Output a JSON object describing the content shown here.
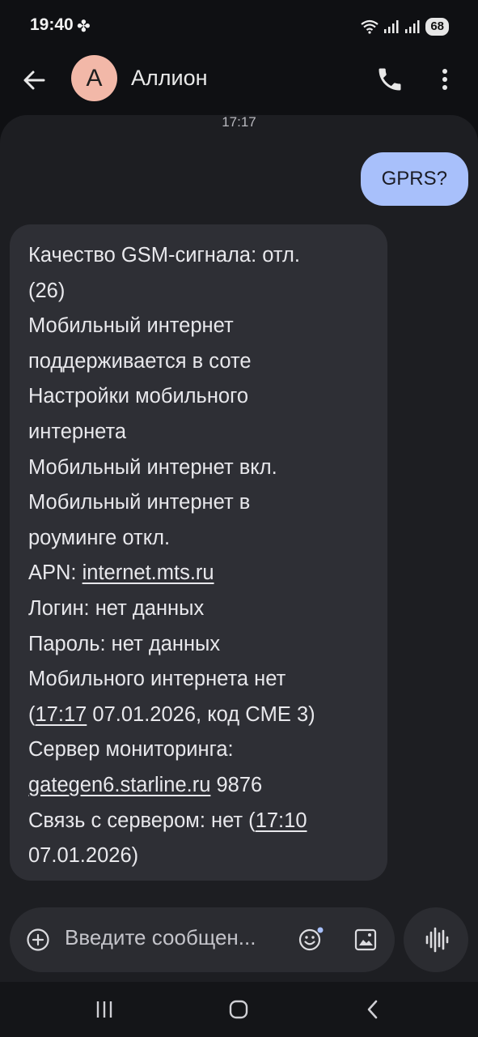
{
  "status_bar": {
    "time": "19:40",
    "battery": "68"
  },
  "contact": {
    "initial": "А",
    "name": "Аллион"
  },
  "conversation": {
    "timestamp": "17:17",
    "outgoing": {
      "text": "GPRS?"
    },
    "incoming": {
      "lines": [
        "Качество GSM-сигнала: отл.",
        "(26)",
        "Мобильный интернет",
        "поддерживается в соте",
        "Настройки мобильного",
        "интернета",
        "Мобильный интернет вкл.",
        "Мобильный интернет в",
        "роуминге откл.",
        "APN: internet.mts.ru",
        "Логин: нет данных",
        "Пароль: нет данных",
        "Мобильного интернета нет",
        "(17:17 07.01.2026, код CME 3)",
        "Сервер мониторинга:",
        "gategen6.starline.ru 9876",
        "Связь с сервером: нет (17:10",
        "07.01.2026)"
      ],
      "apn_prefix": "APN: ",
      "apn_link": "internet.mts.ru",
      "err_open": "(",
      "err_time_link": "17:17",
      "err_rest": " 07.01.2026, код CME 3)",
      "server_link": "gategen6.starline.ru",
      "server_port": " 9876",
      "conn_prefix": "Связь с сервером: нет (",
      "conn_time_link": "17:10"
    }
  },
  "compose": {
    "placeholder": "Введите сообщен..."
  },
  "icons": {
    "back": "arrow-left-icon",
    "call": "phone-icon",
    "more": "more-vert-icon",
    "add": "add-circle-icon",
    "emoji": "emoji-icon",
    "gallery": "gallery-icon",
    "voice": "voice-wave-icon",
    "nav_recents": "recents-icon",
    "nav_home": "home-icon",
    "nav_back": "nav-back-icon"
  },
  "colors": {
    "background": "#0f1013",
    "conversation_bg": "#1d1e22",
    "outgoing_bubble": "#a8c0fb",
    "incoming_bubble": "#2e2f35",
    "avatar": "#f2b8a8"
  }
}
